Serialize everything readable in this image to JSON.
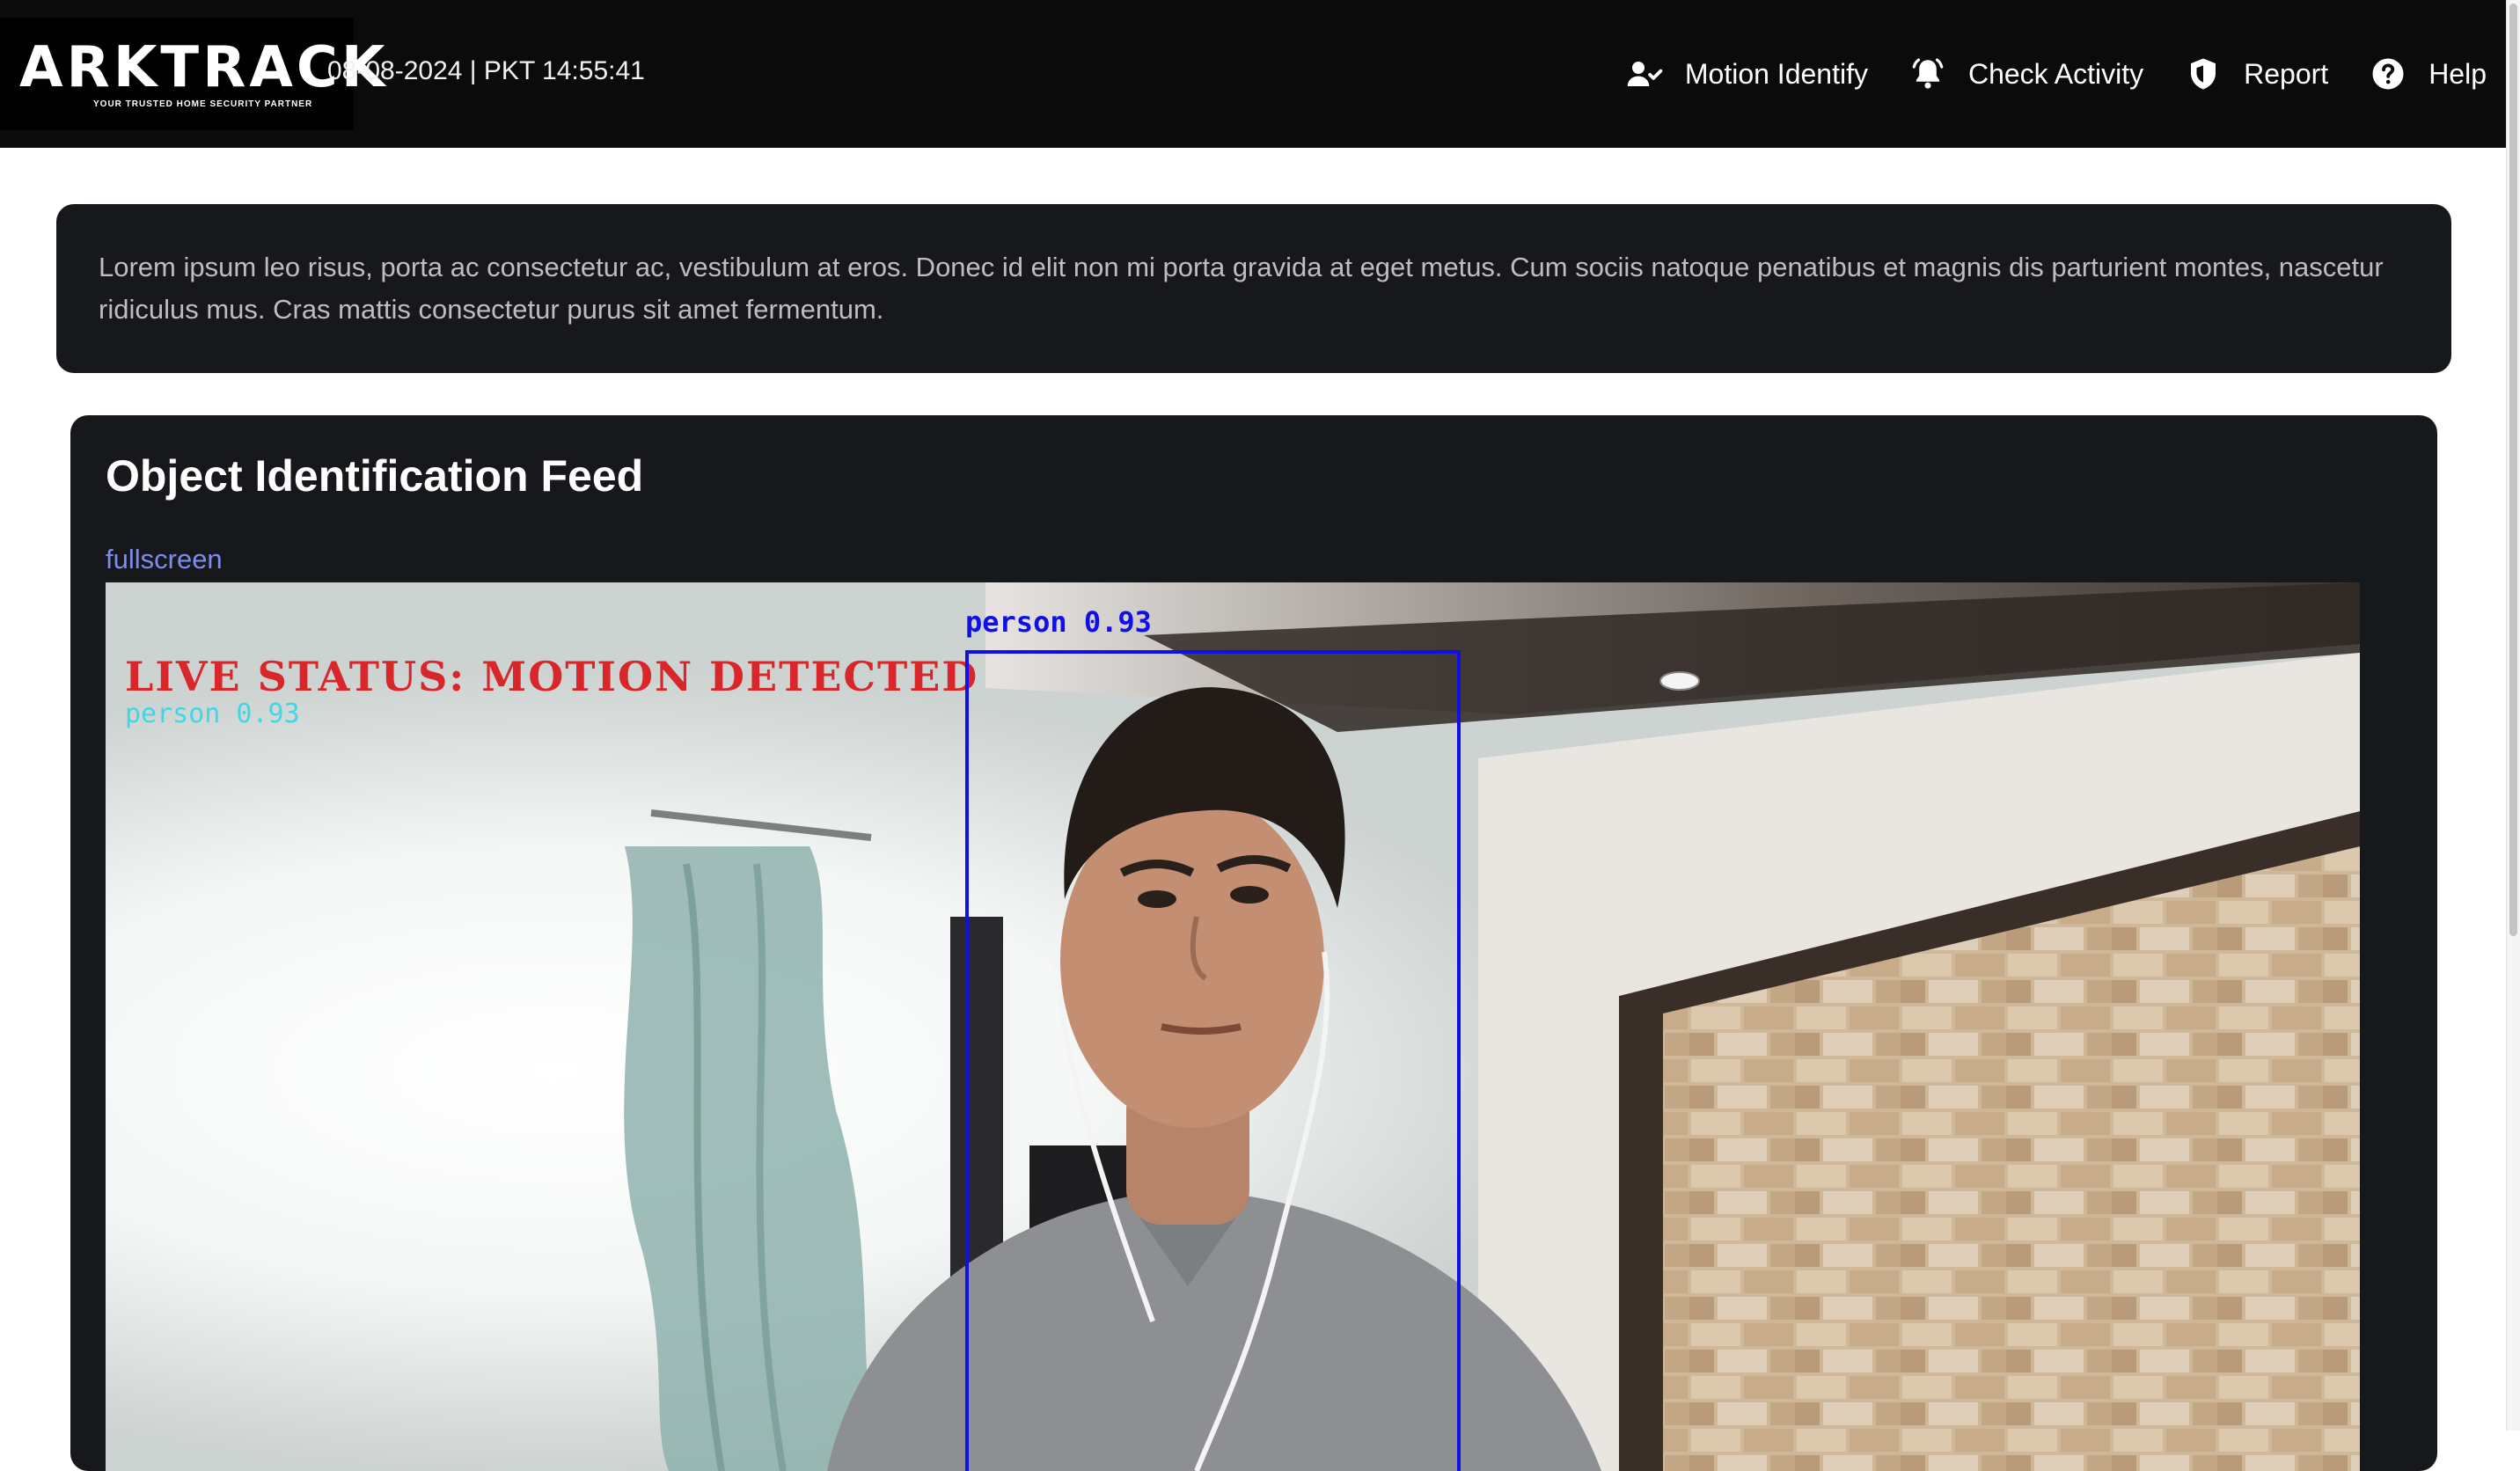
{
  "header": {
    "logo": {
      "word": "ARKTRACK",
      "tagline": "YOUR TRUSTED HOME SECURITY PARTNER"
    },
    "datetime": "08-08-2024 | PKT 14:55:41",
    "nav": [
      {
        "label": "Motion Identify",
        "icon": "user-check-icon"
      },
      {
        "label": "Check Activity",
        "icon": "bell-icon"
      },
      {
        "label": "Report",
        "icon": "shield-icon"
      },
      {
        "label": "Help",
        "icon": "question-circle-icon"
      }
    ]
  },
  "banner": {
    "text": "Lorem ipsum leo risus, porta ac consectetur ac, vestibulum at eros. Donec id elit non mi porta gravida at eget metus. Cum sociis natoque penatibus et magnis dis parturient montes, nascetur ridiculus mus. Cras mattis consectetur purus sit amet fermentum."
  },
  "feed": {
    "title": "Object Identification Feed",
    "fullscreen_label": "fullscreen",
    "overlay": {
      "status": "LIVE STATUS: MOTION DETECTED",
      "secondary_label": "person 0.93",
      "detection_label": "person 0.93"
    }
  },
  "colors": {
    "header_bg": "#0b0b0c",
    "card_bg": "#17181b",
    "link": "#7d8cf0",
    "status_red": "#d8262a",
    "bbox_blue": "#1010e6",
    "label_cyan": "#27d7ea"
  }
}
